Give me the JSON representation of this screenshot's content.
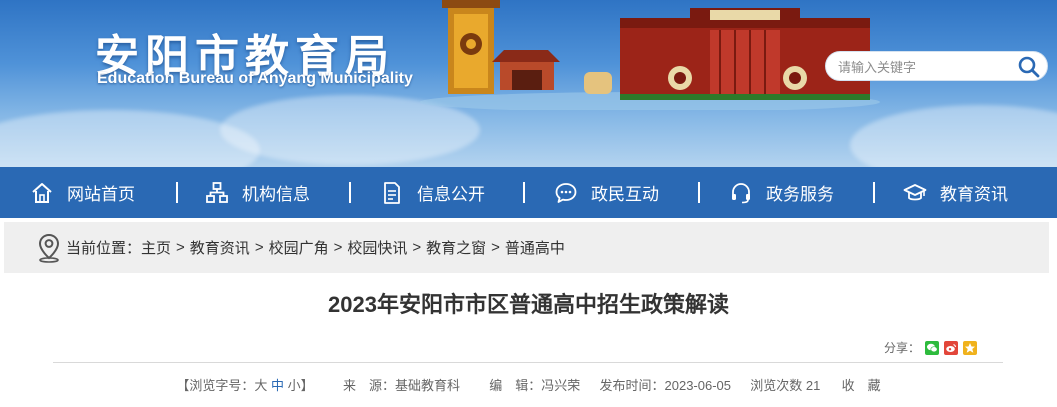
{
  "header": {
    "title": "安阳市教育局",
    "subtitle": "Education Bureau  of Anyang Municipality",
    "search_placeholder": "请输入关键字",
    "colors": {
      "banner_top": "#2f74c4",
      "banner_bottom": "#b3d3ef"
    }
  },
  "nav": {
    "color": "#2a69b4",
    "items": [
      {
        "label": "网站首页",
        "icon": "home-icon"
      },
      {
        "label": "机构信息",
        "icon": "org-chart-icon"
      },
      {
        "label": "信息公开",
        "icon": "document-icon"
      },
      {
        "label": "政民互动",
        "icon": "chat-icon"
      },
      {
        "label": "政务服务",
        "icon": "headset-icon"
      },
      {
        "label": "教育资讯",
        "icon": "graduation-cap-icon"
      }
    ]
  },
  "breadcrumb": {
    "label": "当前位置：",
    "separator": ">",
    "items": [
      "主页",
      "教育资讯",
      "校园广角",
      "校园快讯",
      "教育之窗",
      "普通高中"
    ]
  },
  "article": {
    "title": "2023年安阳市市区普通高中招生政策解读",
    "share_label": "分享：",
    "meta": {
      "font_size_label": "【浏览字号：",
      "size_large": "大",
      "size_medium": "中",
      "size_small": "小",
      "font_size_close": "】",
      "source_label": "来　源：",
      "source": "基础教育科",
      "editor_label": "编　辑：",
      "editor": "冯兴荣",
      "date_label": "发布时间：",
      "date": "2023-06-05",
      "views_label": "浏览次数",
      "views": "21",
      "favorite": "收　藏"
    }
  }
}
